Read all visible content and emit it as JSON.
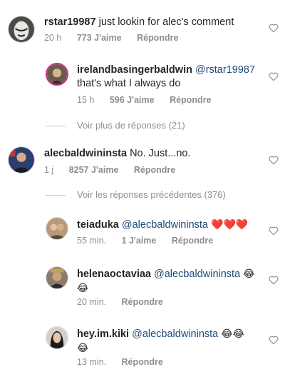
{
  "comments": [
    {
      "username": "rstar19987",
      "text": "just lookin for alec's comment",
      "time": "20 h",
      "likes": "773 J'aime",
      "reply": "Répondre"
    },
    {
      "username": "irelandbasingerbaldwin",
      "mention": "@rstar19987",
      "text": "that's what I always do",
      "time": "15 h",
      "likes": "596 J'aime",
      "reply": "Répondre"
    },
    {
      "view_more": "Voir plus de réponses (21)"
    },
    {
      "username": "alecbaldwininsta",
      "text": "No. Just...no.",
      "time": "1 j",
      "likes": "8257 J'aime",
      "reply": "Répondre"
    },
    {
      "view_prev": "Voir les réponses précédentes (376)"
    },
    {
      "username": "teiaduka",
      "mention": "@alecbaldwininsta",
      "emoji": "❤️❤️❤️",
      "time": "55 min.",
      "likes": "1 J'aime",
      "reply": "Répondre"
    },
    {
      "username": "helenaoctaviaa",
      "mention": "@alecbaldwininsta",
      "emoji": "😂",
      "emoji2": "😂",
      "time": "20 min.",
      "reply": "Répondre"
    },
    {
      "username": "hey.im.kiki",
      "mention": "@alecbaldwininsta",
      "emoji": "😂😂",
      "emoji2": "😂",
      "time": "13 min.",
      "reply": "Répondre"
    }
  ],
  "colors": {
    "meta": "#8e8e8e",
    "mention": "#1e4a7a",
    "heart_red": "#e0232e"
  }
}
